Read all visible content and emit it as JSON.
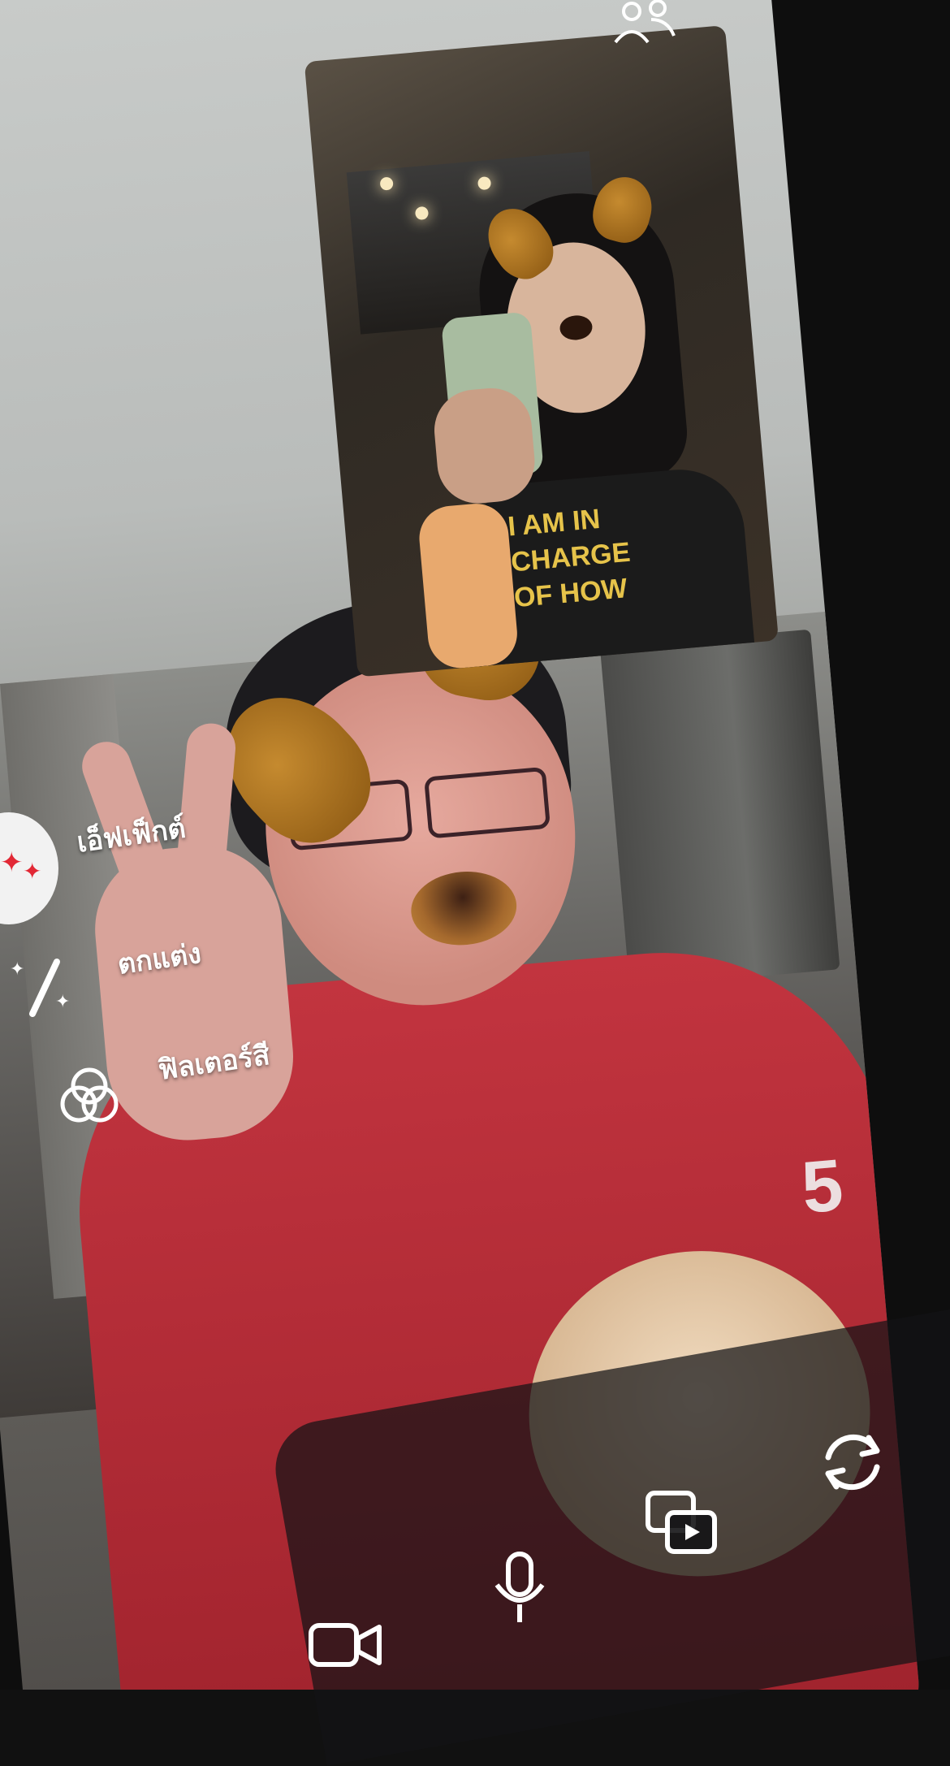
{
  "side_menu": {
    "effects_label": "เอ็ฟเฟ็กต์",
    "touchup_label": "ตกแต่ง",
    "filter_label": "ฟิลเตอร์สี"
  },
  "remote_shirt": {
    "lines": [
      "I AM IN",
      "CHARGE",
      "OF HOW"
    ]
  },
  "shirt_logo": "5",
  "icons": {
    "top": "people-icon",
    "effects": "sparkle-stars-icon",
    "touchup": "magic-wand-icon",
    "filter": "color-circles-icon",
    "camera": "video-camera-icon",
    "mic": "microphone-icon",
    "media": "photo-video-icon",
    "flip": "flip-camera-icon"
  },
  "colors": {
    "accent_red": "#e22835",
    "toolbar_bg": "#141416",
    "icon_white": "#ffffff"
  }
}
